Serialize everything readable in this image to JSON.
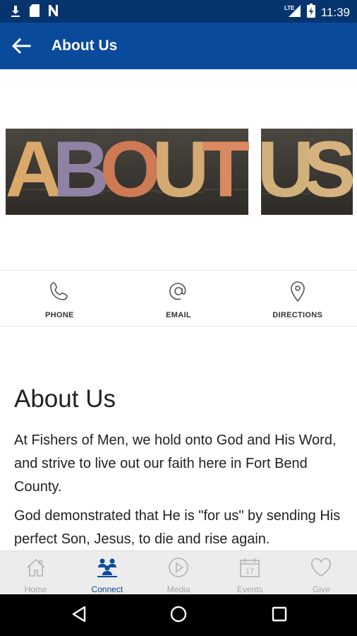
{
  "status_bar": {
    "time": "11:39",
    "network": "LTE",
    "icons": [
      "download-icon",
      "sim-card-icon",
      "n-notification-icon",
      "signal-icon",
      "battery-icon"
    ]
  },
  "app_bar": {
    "title": "About Us",
    "back_icon": "arrow-left-icon"
  },
  "hero": {
    "letters": [
      "A",
      "B",
      "O",
      "U",
      "T",
      "U",
      "S"
    ],
    "alt": "ABOUT US"
  },
  "actions": [
    {
      "label": "PHONE",
      "icon": "phone-icon"
    },
    {
      "label": "EMAIL",
      "icon": "at-icon"
    },
    {
      "label": "DIRECTIONS",
      "icon": "location-pin-icon"
    }
  ],
  "content": {
    "title": "About Us",
    "paragraphs": [
      "At Fishers of Men, we hold onto God and His Word, and strive to live out our faith here in Fort Bend County.",
      "God demonstrated that He is \"for us\" by sending His perfect Son, Jesus, to die and rise again."
    ]
  },
  "bottom_nav": {
    "items": [
      {
        "label": "Home",
        "icon": "home-icon",
        "active": false
      },
      {
        "label": "Connect",
        "icon": "people-icon",
        "active": true
      },
      {
        "label": "Media",
        "icon": "play-icon",
        "active": false
      },
      {
        "label": "Events",
        "icon": "calendar-icon",
        "active": false,
        "day": "17"
      },
      {
        "label": "Give",
        "icon": "heart-icon",
        "active": false
      }
    ]
  },
  "colors": {
    "status_bar": "#06346f",
    "app_bar": "#0a4a9b",
    "accent": "#0a4a9b",
    "inactive": "#a7a7a7"
  }
}
